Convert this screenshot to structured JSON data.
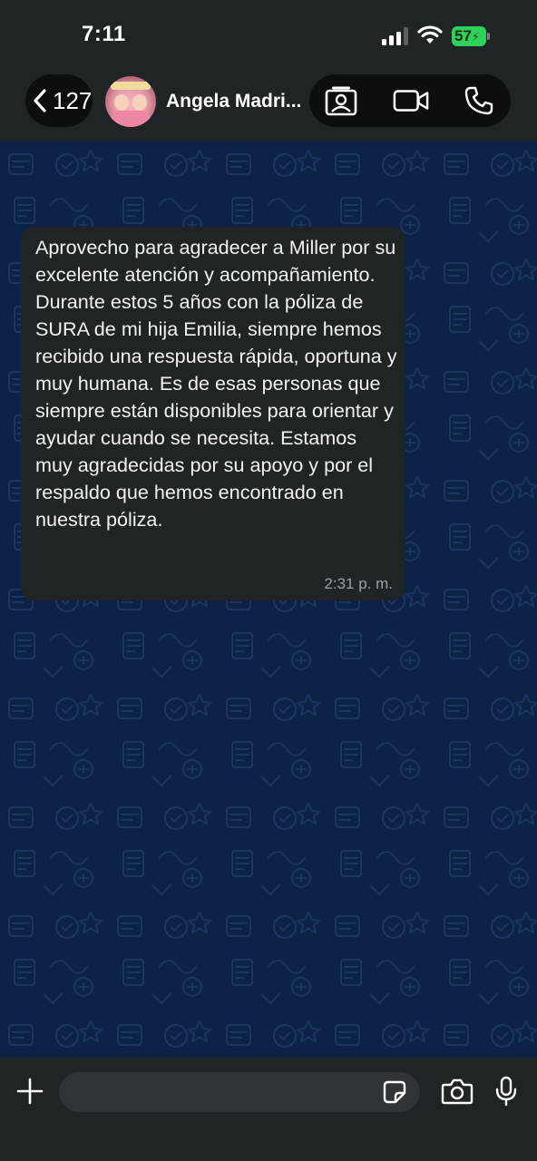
{
  "status_bar": {
    "time": "7:11",
    "battery_level": "57",
    "signal": "signal-icon",
    "wifi": "wifi-icon"
  },
  "header": {
    "back_count": "127",
    "contact_name": "Angela Madri...",
    "avatar_icon": "contact-avatar",
    "actions": [
      "video-call-icon",
      "phone-icon",
      "contact-card-icon"
    ]
  },
  "chat": {
    "messages": [
      {
        "text": "Aprovecho para agradecer a Miller por su excelente atención y acompañamiento. Durante estos 5 años con la póliza de SURA de mi hija Emilia, siempre hemos recibido una respuesta rápida, oportuna y muy humana. Es de esas personas que siempre están disponibles para orientar y ayudar cuando se necesita. Estamos muy agradecidas por su apoyo y por el respaldo que hemos encontrado en nuestra póliza.",
        "time": "2:31 p. m."
      }
    ]
  },
  "composer": {
    "value": "",
    "icons": [
      "plus-icon",
      "sticker-icon",
      "camera-icon",
      "microphone-icon"
    ]
  },
  "colors": {
    "background": "#0d2247",
    "bar": "#1f2427",
    "bubble": "#1f2427",
    "battery": "#30d158"
  }
}
